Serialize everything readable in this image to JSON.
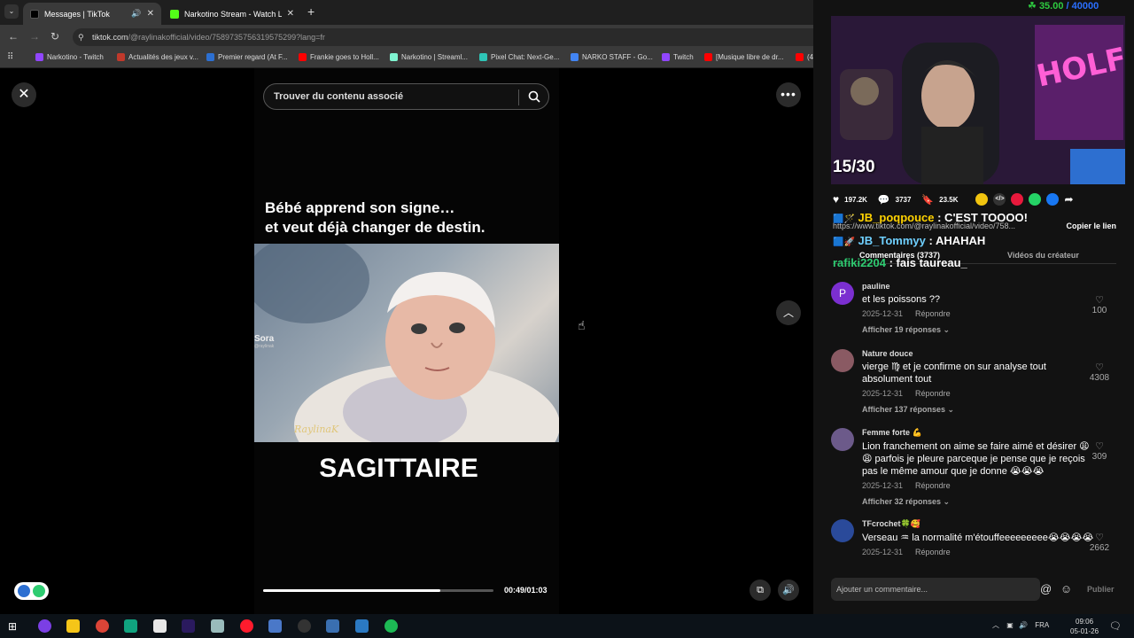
{
  "browser": {
    "tabs": [
      {
        "label": "Messages | TikTok",
        "active": true,
        "has_audio": true
      },
      {
        "label": "Narkotino Stream - Watch Live",
        "active": false
      }
    ],
    "new_tab": "+",
    "url_host": "tiktok.com",
    "url_path": "/@raylinakofficial/video/7589735756319575299?lang=fr",
    "bookmarks": [
      "Narkotino - Twitch",
      "Actualités des jeux v...",
      "Premier regard (At F...",
      "Frankie goes to Holl...",
      "Narkotino | Streaml...",
      "Pixel Chat: Next-Ge...",
      "NARKO STAFF - Go...",
      "Twitch",
      "[Musique libre de dr...",
      "(4) Are"
    ]
  },
  "viewer": {
    "close_glyph": "✕",
    "more_glyph": "•••",
    "up_glyph": "︿",
    "search_placeholder": "Trouver du contenu associé",
    "caption_line1": "Bébé apprend son signe…",
    "caption_line2": "et veut déjà changer de destin.",
    "watermark": "Sora",
    "watermark_handle": "@raylinak",
    "signature": "RaylinaK",
    "sign": "SAGITTAIRE",
    "progress": 0.77,
    "timecode": "00:49/01:03"
  },
  "stream_overlay": {
    "counter": "35.00",
    "goal": "/ 40000",
    "page_count": "15/30"
  },
  "actions": {
    "likes": "197.2K",
    "comments": "3737",
    "saves": "23.5K"
  },
  "chat": [
    {
      "user": "JB_poqpouce",
      "text": " : C'EST TOOOO!"
    },
    {
      "user": "JB_Tommyy",
      "text": " : AHAHAH"
    },
    {
      "user": "rafiki2204",
      "text": " : fais taureau_"
    }
  ],
  "link": {
    "url": "https://www.tiktok.com/@raylinakofficial/video/758...",
    "copy_label": "Copier le lien"
  },
  "panel_tabs": {
    "comments": "Commentaires (3737)",
    "creator_videos": "Vidéos du créateur"
  },
  "comments": [
    {
      "user": "pauline",
      "text": "et les poissons ??",
      "date": "2025-12-31",
      "reply": "Répondre",
      "replies": "Afficher 19 réponses",
      "likes": "100",
      "avatar_letter": "P",
      "avatar_color": "#7b2fd0"
    },
    {
      "user": "Nature douce",
      "text": "vierge ♍ et je confirme on sur analyse tout absolument tout",
      "date": "2025-12-31",
      "reply": "Répondre",
      "replies": "Afficher 137 réponses",
      "likes": "4308",
      "avatar_letter": "",
      "avatar_color": "#8a5a63"
    },
    {
      "user": "Femme forte 💪",
      "text": "Lion franchement on aime se faire aimé et désirer 😩😩 parfois je pleure parceque je pense que je reçois pas le même amour que je donne 😭😭😭",
      "date": "2025-12-31",
      "reply": "Répondre",
      "replies": "Afficher 32 réponses",
      "likes": "309",
      "avatar_letter": "",
      "avatar_color": "#6c5a8a"
    },
    {
      "user": "TFcrochet🍀🥰",
      "text": "Verseau ♒ la normalité m'étouffeeeeeeeee😭😭😭😭",
      "date": "2025-12-31",
      "reply": "Répondre",
      "replies": "",
      "likes": "2662",
      "avatar_letter": "",
      "avatar_color": "#2a4a9a"
    }
  ],
  "composer": {
    "placeholder": "Ajouter un commentaire...",
    "publish": "Publier"
  },
  "taskbar": {
    "lang": "FRA",
    "time": "09:06",
    "date": "05-01-26"
  }
}
